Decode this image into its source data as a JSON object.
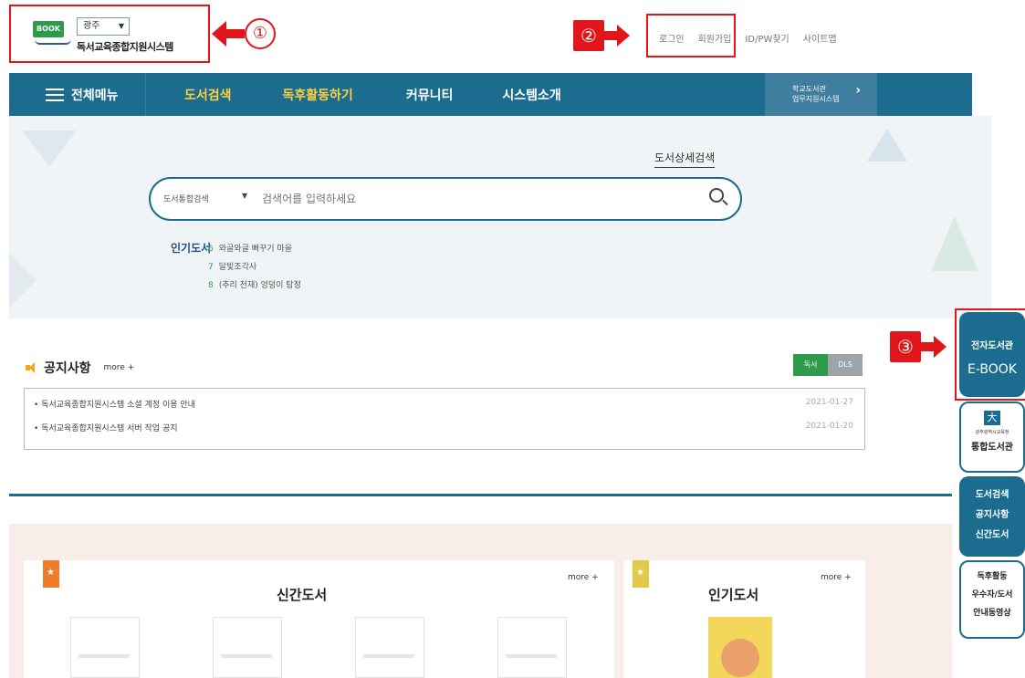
{
  "header": {
    "logo_badge": "BOOK",
    "region": "광주",
    "site_title": "독서교육종합지원시스템",
    "callouts": [
      "①",
      "②",
      "③"
    ],
    "util_links": [
      "로그인",
      "회원가입",
      "ID/PW찾기",
      "사이트맵"
    ]
  },
  "nav": {
    "menu_label": "전체메뉴",
    "items": [
      "도서검색",
      "독후활동하기",
      "커뮤니티",
      "시스템소개"
    ],
    "side_line1": "학교도서관",
    "side_line2": "업무지원시스템"
  },
  "search": {
    "detail_link": "도서상세검색",
    "type_label": "도서통합검색",
    "placeholder": "검색어를 입력하세요",
    "popular_label": "인기도서",
    "popular_items": [
      {
        "rank": "6",
        "title": "와글와글 뻐꾸기 마을"
      },
      {
        "rank": "7",
        "title": "달빛조각사"
      },
      {
        "rank": "8",
        "title": "(추리 천재) 엉덩이 탐정"
      }
    ]
  },
  "notice": {
    "title": "공지사항",
    "more": "more +",
    "tabs": [
      "독서",
      "DLS"
    ],
    "items": [
      {
        "text": "• 독서교육종합지원시스템 소셜 계정 이용 안내",
        "date": "2021-01-27"
      },
      {
        "text": "• 독서교육종합지원시스템 서버 작업 공지",
        "date": "2021-01-20"
      }
    ]
  },
  "books": {
    "new_title": "신간도서",
    "new_more": "more +",
    "popular_title": "인기도서",
    "popular_more": "more +"
  },
  "sidebar": {
    "ebook_line1": "전자도서관",
    "ebook_line2": "E-BOOK",
    "lib_org": "광주광역시교육청",
    "lib_name": "통합도서관",
    "links": [
      "도서검색",
      "공지사항",
      "신간도서"
    ],
    "links2": [
      "독후활동",
      "우수자/도서",
      "안내동영상"
    ]
  },
  "colors": {
    "nav": "#1b6c8e",
    "accent_yellow": "#fbd23e",
    "callout_red": "#e0161a",
    "green": "#2e9b4a"
  }
}
